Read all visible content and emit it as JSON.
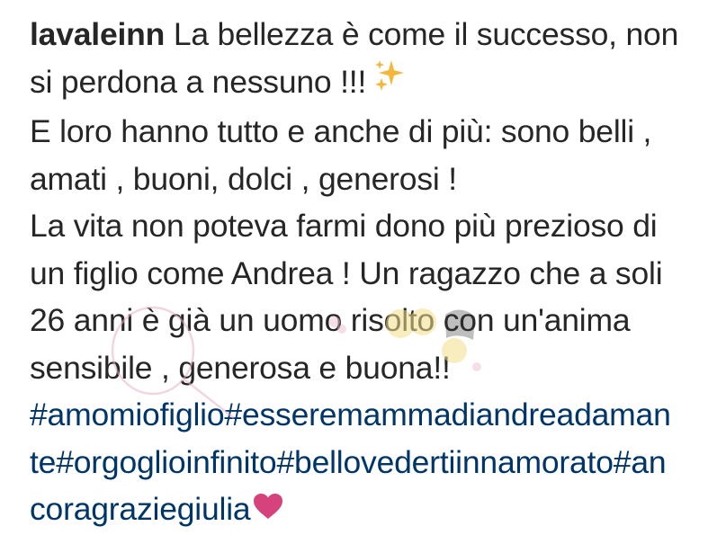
{
  "post": {
    "username": "lavaleinn",
    "caption_lines": [
      "La bellezza è come il successo, non",
      "si perdona a nessuno !!!",
      "E loro hanno tutto e anche di più: sono belli ,",
      "amati , buoni, dolci , generosi !",
      "La vita non poteva farmi dono più prezioso di",
      "un figlio come Andrea ! Un ragazzo che a soli",
      "26 anni è già un uomo risolto con un'anima",
      "sensibile , generosa e buona!!"
    ],
    "hashtag_lines": [
      "#amomiofiglio#esseremammadiandreadaman",
      "te#orgoglioinfinito#bellovedertiinnamorato#an",
      "coragraziegiulia"
    ],
    "sparkles_emoji": "sparkles-icon",
    "heart_emoji": "heart-icon",
    "colors": {
      "text": "#262626",
      "hashtag": "#003569",
      "sparkle": "#f4b73b",
      "heart": "#d6427b"
    }
  }
}
